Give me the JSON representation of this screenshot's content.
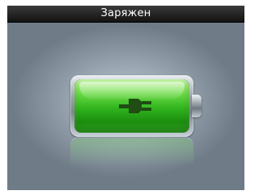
{
  "status_bar": {
    "title": "Заряжен"
  },
  "battery": {
    "level": 1.0,
    "state_icon": "plug-icon",
    "fill_color": "#2fb31d"
  },
  "colors": {
    "status_bar_bg": "#1e1e1e",
    "status_text": "#ffffff",
    "screen_bg": "#9ba8b4"
  }
}
